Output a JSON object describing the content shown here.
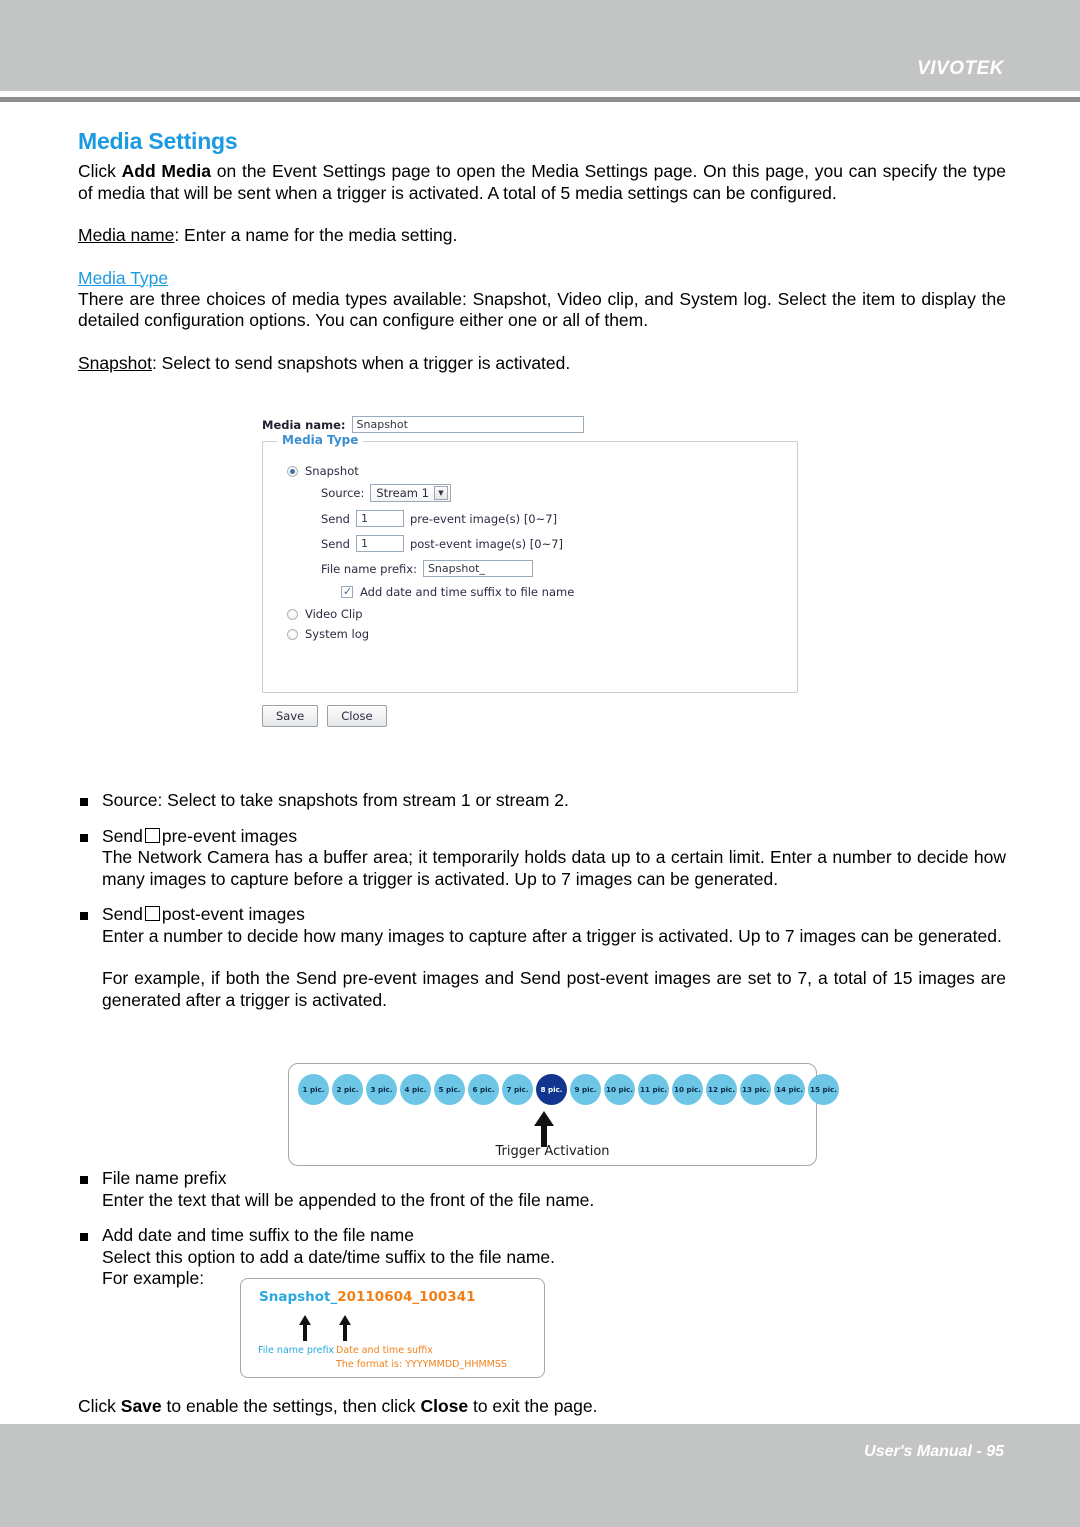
{
  "page": {
    "brand": "VIVOTEK",
    "footer": "User's Manual - 95",
    "accent_blue": "#1b9ae2",
    "band_gray": "#c3c4c4",
    "rule_gray": "#8d8e8e"
  },
  "section": {
    "title": "Media Settings",
    "intro_part1": "Click ",
    "intro_bold": "Add Media",
    "intro_part2": " on the Event Settings page to open the Media Settings page. On this page, you can specify the type of media that will be sent when a trigger is activated. A total of 5 media settings can be configured.",
    "media_name_term": "Media name",
    "media_name_desc": ": Enter a name for the media setting.",
    "media_type_heading": "Media Type",
    "media_type_desc": "There are three choices of media types available: Snapshot, Video clip, and System log. Select the item to display the detailed configuration options. You can configure either one or all of them.",
    "snapshot_term": "Snapshot",
    "snapshot_desc": ": Select to send snapshots when a trigger is activated."
  },
  "form": {
    "media_name_label": "Media name:",
    "media_name_value": "Snapshot",
    "legend": "Media Type",
    "radio_snapshot": "Snapshot",
    "radio_videoclip": "Video Clip",
    "radio_systemlog": "System log",
    "source_label": "Source:",
    "source_value": "Stream 1",
    "send_label": "Send",
    "pre_event_value": "1",
    "pre_event_suffix": "pre-event image(s) [0~7]",
    "post_event_value": "1",
    "post_event_suffix": "post-event image(s) [0~7]",
    "prefix_label": "File name prefix:",
    "prefix_value": "Snapshot_",
    "suffix_checkbox_label": "Add date and time suffix to file name",
    "save_label": "Save",
    "close_label": "Close"
  },
  "bullets": {
    "source": {
      "heading": "Source: Select to take snapshots from stream 1 or stream 2."
    },
    "pre_event": {
      "head_a": "Send",
      "head_b": "pre-event images",
      "body": "The Network Camera has a buffer area; it temporarily holds data up to a certain limit. Enter a number to decide how many images to capture before a trigger is activated. Up to 7 images can be generated."
    },
    "post_event": {
      "head_a": "Send",
      "head_b": "post-event images",
      "body": "Enter a number to decide how many images to capture after a trigger is activated. Up to 7 images can be generated.",
      "example": "For example, if both the Send pre-event images and Send post-event images are set to 7, a total of 15 images are generated after a trigger is activated."
    },
    "file_prefix": {
      "heading": "File name prefix",
      "body": "Enter the text that will be appended to the front of the file name."
    },
    "date_suffix": {
      "heading": "Add date and time suffix to the file name",
      "body": "Select this option to add a date/time suffix to the file name.",
      "for_example": "For example:"
    }
  },
  "trigger_diagram": {
    "pics": [
      "1 pic.",
      "2 pic.",
      "3 pic.",
      "4 pic.",
      "5 pic.",
      "6 pic.",
      "7 pic.",
      "8 pic.",
      "9 pic.",
      "10 pic.",
      "11 pic.",
      "10 pic.",
      "12 pic.",
      "13 pic.",
      "14 pic.",
      "15 pic."
    ],
    "active_index": 7,
    "caption": "Trigger Activation",
    "dot_color": "#6ec6e6",
    "active_dot_color": "#12368f"
  },
  "example_box": {
    "prefix_text": "Snapshot_",
    "suffix_text": "20110604_100341",
    "caption_prefix": "File name prefix",
    "caption_suffix": "Date and time suffix",
    "caption_format": "The format is: YYYYMMDD_HHMMSS",
    "prefix_color": "#2aa8e0",
    "suffix_color": "#f0811a"
  },
  "closing": {
    "part1": "Click ",
    "bold1": "Save",
    "part2": " to enable the settings, then click ",
    "bold2": "Close",
    "part3": " to exit the page."
  }
}
